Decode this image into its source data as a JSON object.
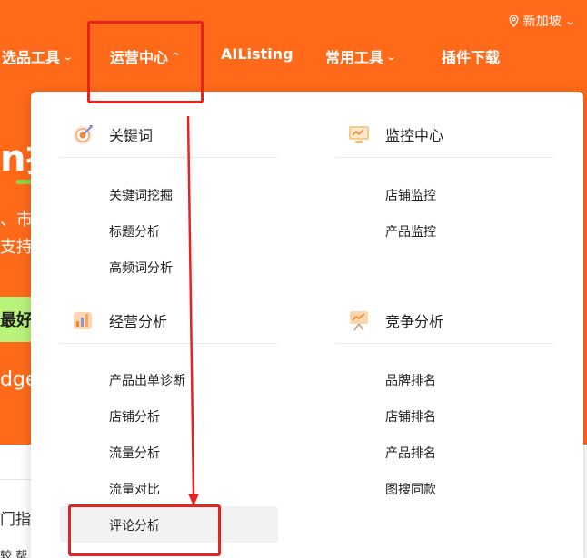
{
  "topbar": {
    "region": "新加坡"
  },
  "nav": {
    "items": [
      {
        "label": "选品工具",
        "caret": "⌵"
      },
      {
        "label": "运营中心",
        "caret": "⌃"
      },
      {
        "label": "AIListing",
        "caret": ""
      },
      {
        "label": "常用工具",
        "caret": "⌵"
      },
      {
        "label": "插件下载",
        "caret": ""
      }
    ]
  },
  "hero": {
    "title_partial": "n插",
    "line2_partial": "、市",
    "line3_partial": "支持",
    "button_partial": "最好",
    "line5_partial": "dge"
  },
  "below": {
    "heading_partial": "门指",
    "small_partial": "较  帮"
  },
  "dropdown": {
    "sections": [
      {
        "title": "关键词",
        "icon": "target-icon",
        "items": [
          "关键词挖掘",
          "标题分析",
          "高频词分析"
        ]
      },
      {
        "title": "监控中心",
        "icon": "monitor-icon",
        "items": [
          "店铺监控",
          "产品监控"
        ]
      },
      {
        "title": "经营分析",
        "icon": "bar-chart-icon",
        "items": [
          "产品出单诊断",
          "店铺分析",
          "流量分析",
          "流量对比",
          "评论分析"
        ]
      },
      {
        "title": "竞争分析",
        "icon": "presentation-icon",
        "items": [
          "品牌排名",
          "店铺排名",
          "产品排名",
          "图搜同款"
        ]
      }
    ]
  },
  "colors": {
    "brand_orange": "#ff6a1a",
    "annotation_red": "#e8231f",
    "accent_green": "#b8f27a"
  }
}
